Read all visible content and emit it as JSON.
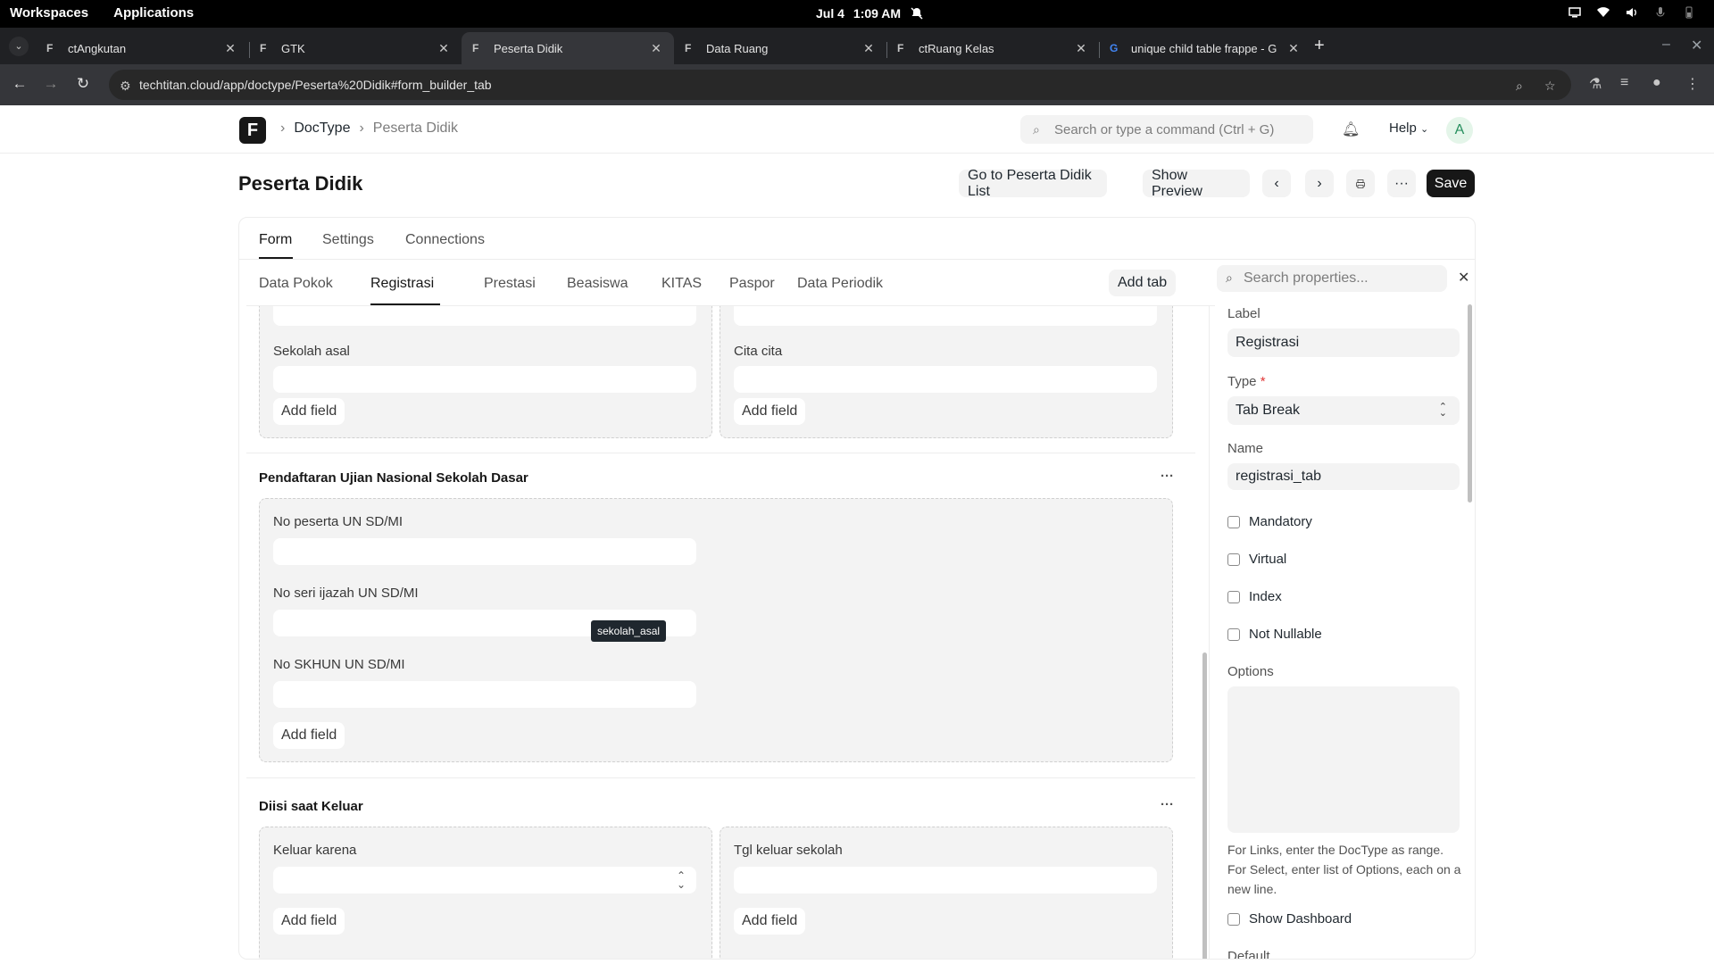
{
  "os": {
    "workspaces": "Workspaces",
    "applications": "Applications",
    "date": "Jul 4",
    "time": "1:09 AM"
  },
  "browser": {
    "tabs": [
      {
        "title": "ctAngkutan"
      },
      {
        "title": "GTK"
      },
      {
        "title": "Peserta Didik"
      },
      {
        "title": "Data Ruang"
      },
      {
        "title": "ctRuang Kelas"
      },
      {
        "title": "unique child table frappe - G"
      }
    ],
    "url": "techtitan.cloud/app/doctype/Peserta%20Didik#form_builder_tab"
  },
  "navbar": {
    "logo": "F",
    "breadcrumb_root": "DocType",
    "breadcrumb_current": "Peserta Didik",
    "search_placeholder": "Search or type a command (Ctrl + G)",
    "help": "Help",
    "avatar": "A"
  },
  "page": {
    "title": "Peserta Didik",
    "go_to_list": "Go to Peserta Didik List",
    "show_preview": "Show Preview",
    "more": "···",
    "save": "Save"
  },
  "doc_tabs": [
    "Form",
    "Settings",
    "Connections"
  ],
  "builder": {
    "tabs": [
      "Data Pokok",
      "Registrasi",
      "Prestasi",
      "Beasiswa",
      "KITAS",
      "Paspor",
      "Data Periodik"
    ],
    "add_tab": "Add tab",
    "add_field": "Add field",
    "section_menu": "···",
    "tooltip": "sekolah_asal",
    "top_left_field": "Sekolah asal",
    "top_right_field": "Cita cita",
    "section1": {
      "title": "Pendaftaran Ujian Nasional Sekolah Dasar",
      "fields": [
        "No peserta UN SD/MI",
        "No seri ijazah UN SD/MI",
        "No SKHUN UN SD/MI"
      ]
    },
    "section2": {
      "title": "Diisi saat Keluar",
      "left_field": "Keluar karena",
      "right_field": "Tgl keluar sekolah"
    }
  },
  "properties": {
    "search_placeholder": "Search properties...",
    "label_label": "Label",
    "label_value": "Registrasi",
    "type_label": "Type",
    "type_required": "*",
    "type_value": "Tab Break",
    "name_label": "Name",
    "name_value": "registrasi_tab",
    "checkboxes": [
      "Mandatory",
      "Virtual",
      "Index",
      "Not Nullable"
    ],
    "options_label": "Options",
    "options_help": "For Links, enter the DocType as range. For Select, enter list of Options, each on a new line.",
    "show_dashboard": "Show Dashboard",
    "default_label": "Default"
  }
}
